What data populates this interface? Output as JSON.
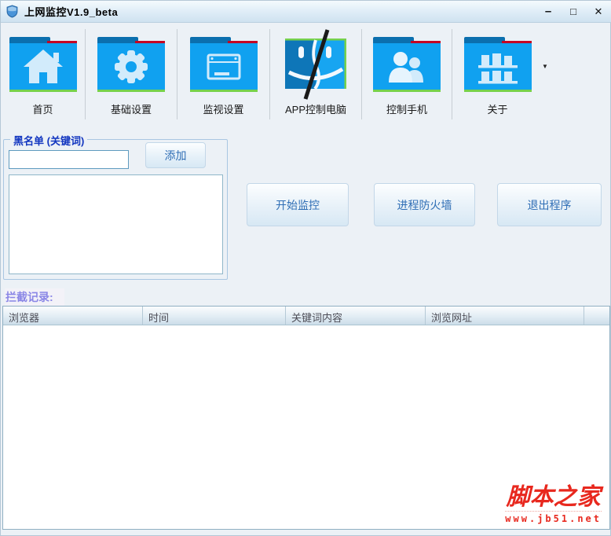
{
  "window": {
    "title": "上网监控V1.9_beta",
    "controls": {
      "minimize": "–",
      "maximize": "□",
      "close": "✕"
    }
  },
  "toolbar": {
    "items": [
      {
        "label": "首页",
        "icon": "home-folder-icon"
      },
      {
        "label": "基础设置",
        "icon": "gear-folder-icon"
      },
      {
        "label": "监视设置",
        "icon": "browser-folder-icon"
      },
      {
        "label": "APP控制电脑",
        "icon": "finder-face-icon"
      },
      {
        "label": "控制手机",
        "icon": "users-folder-icon"
      },
      {
        "label": "关于",
        "icon": "shelf-folder-icon"
      }
    ],
    "dropdown_arrow": "▼"
  },
  "blacklist": {
    "group_label": "黑名单 (关键词)",
    "keyword_input_value": "",
    "add_button_label": "添加",
    "list_items": []
  },
  "actions": {
    "start_button_label": "开始监控",
    "firewall_button_label": "进程防火墙",
    "exit_button_label": "退出程序"
  },
  "records": {
    "section_label": "拦截记录:",
    "columns": [
      "浏览器",
      "时间",
      "关键词内容",
      "浏览网址"
    ],
    "rows": []
  },
  "watermark": {
    "site_name": "脚本之家",
    "site_url": "www.jb51.net"
  },
  "colors": {
    "folder_body_blue": "#10a1f0",
    "folder_tab_blue": "#0b6fae",
    "folder_glyph": "#d2ebfb",
    "accent_red": "#c40023",
    "accent_green": "#76d14c",
    "button_text_blue": "#2f6eb5",
    "group_label_blue": "#1236c0",
    "records_label_purple": "#8a86e6",
    "watermark_red": "#e8281e"
  }
}
